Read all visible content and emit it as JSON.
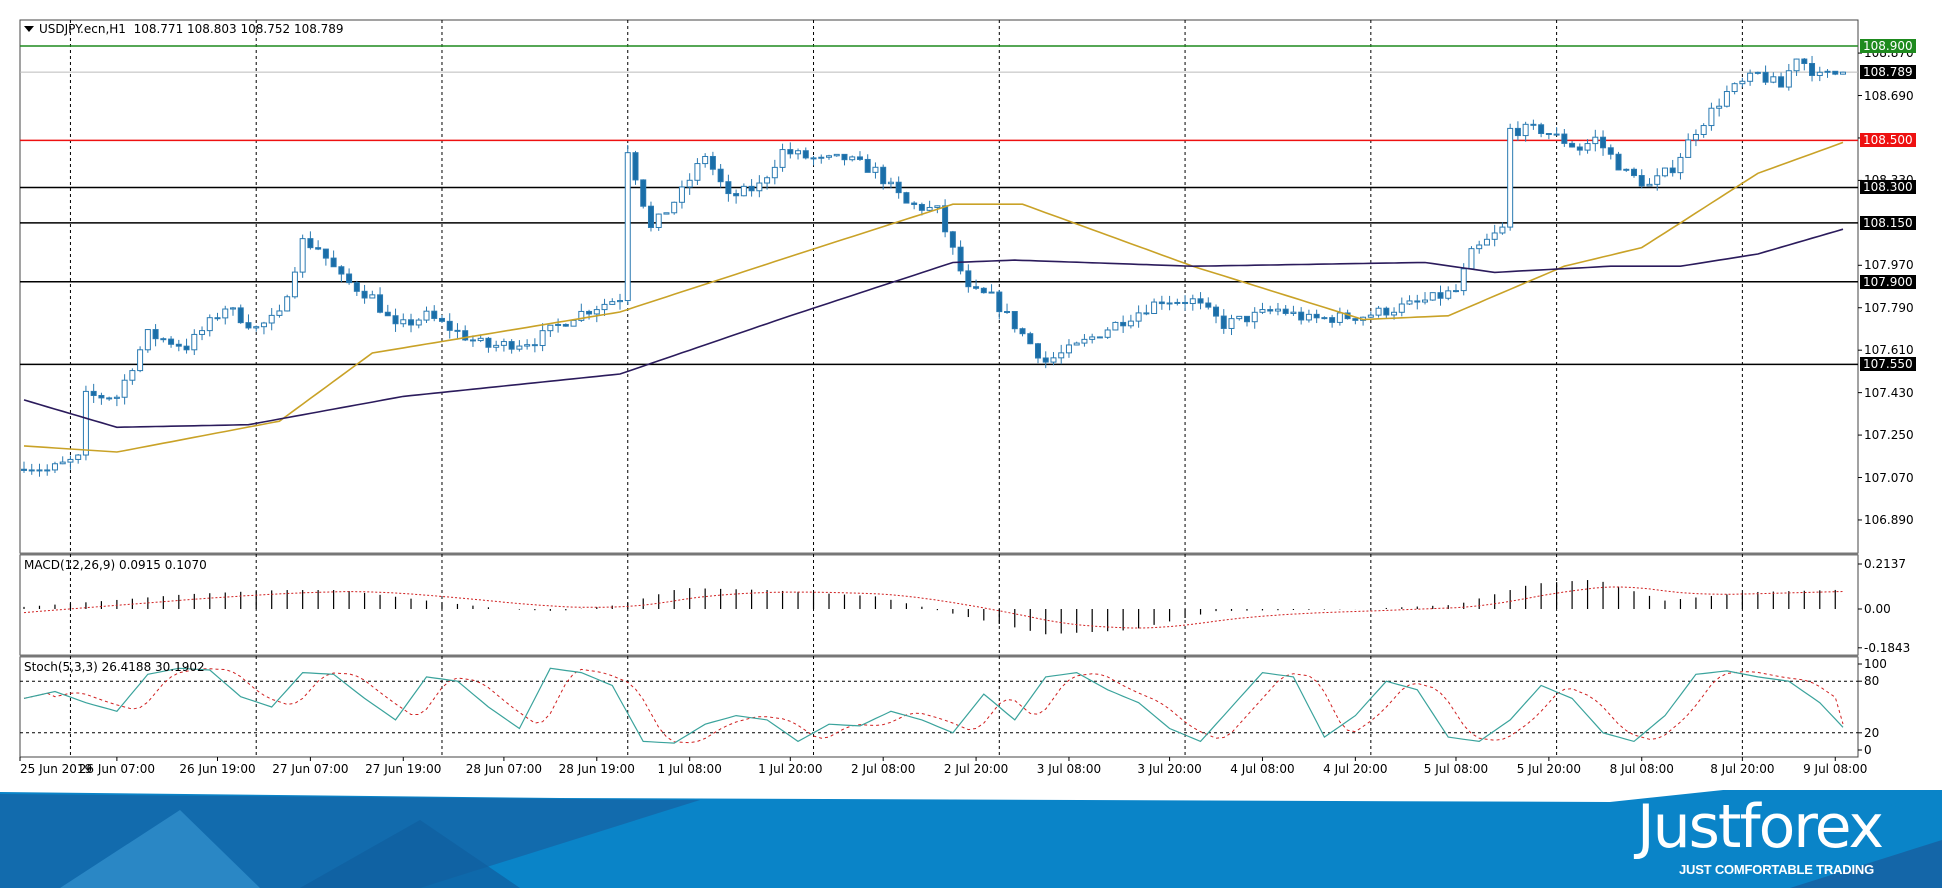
{
  "header": {
    "symbol": "USDJPY.ecn,H1",
    "open": "108.771",
    "high": "108.803",
    "low": "108.752",
    "close": "108.789"
  },
  "colors": {
    "bull_body": "#ffffff",
    "bear_body": "#1a6ea8",
    "candle_outline": "#2a7ab2",
    "ma_fast": "#c9a227",
    "ma_slow": "#2b1b5c",
    "level_green": "#1e8a1e",
    "level_red": "#ee1111",
    "level_black": "#000000",
    "stoch_main": "#3aa39c",
    "stoch_signal": "#d02020",
    "brand_blue": "#0a84c8"
  },
  "chart_data": {
    "type": "candlestick",
    "bars": 236,
    "price_range": [
      106.8,
      109.0
    ],
    "price_ticks": [
      "108.870",
      "108.690",
      "108.510",
      "108.330",
      "107.970",
      "107.790",
      "107.610",
      "107.430",
      "107.250",
      "107.070",
      "106.890"
    ],
    "levels": [
      {
        "price": 108.9,
        "label": "108.900",
        "color": "green"
      },
      {
        "price": 108.789,
        "label": "108.789",
        "color": "bid"
      },
      {
        "price": 108.5,
        "label": "108.500",
        "color": "red"
      },
      {
        "price": 108.3,
        "label": "108.300",
        "color": "black"
      },
      {
        "price": 108.15,
        "label": "108.150",
        "color": "black"
      },
      {
        "price": 107.9,
        "label": "107.900",
        "color": "black"
      },
      {
        "price": 107.55,
        "label": "107.550",
        "color": "black"
      }
    ],
    "close_keypoints": [
      [
        0,
        107.125
      ],
      [
        3,
        107.1
      ],
      [
        7,
        107.15
      ],
      [
        8,
        107.414
      ],
      [
        12,
        107.414
      ],
      [
        16,
        107.677
      ],
      [
        21,
        107.625
      ],
      [
        26,
        107.793
      ],
      [
        30,
        107.703
      ],
      [
        33,
        107.756
      ],
      [
        36,
        108.071
      ],
      [
        38,
        108.045
      ],
      [
        41,
        107.913
      ],
      [
        45,
        107.834
      ],
      [
        48,
        107.703
      ],
      [
        52,
        107.756
      ],
      [
        58,
        107.651
      ],
      [
        60,
        107.625
      ],
      [
        66,
        107.651
      ],
      [
        71,
        107.756
      ],
      [
        77,
        107.834
      ],
      [
        78,
        108.465
      ],
      [
        81,
        108.123
      ],
      [
        85,
        108.281
      ],
      [
        88,
        108.439
      ],
      [
        91,
        108.255
      ],
      [
        95,
        108.307
      ],
      [
        98,
        108.454
      ],
      [
        103,
        108.412
      ],
      [
        106,
        108.423
      ],
      [
        110,
        108.37
      ],
      [
        114,
        108.229
      ],
      [
        118,
        108.202
      ],
      [
        122,
        107.861
      ],
      [
        125,
        107.834
      ],
      [
        129,
        107.677
      ],
      [
        132,
        107.561
      ],
      [
        136,
        107.625
      ],
      [
        140,
        107.703
      ],
      [
        143,
        107.756
      ],
      [
        147,
        107.824
      ],
      [
        151,
        107.819
      ],
      [
        155,
        107.719
      ],
      [
        162,
        107.782
      ],
      [
        166,
        107.74
      ],
      [
        173,
        107.756
      ],
      [
        180,
        107.808
      ],
      [
        185,
        107.861
      ],
      [
        187,
        108.018
      ],
      [
        191,
        108.123
      ],
      [
        192,
        108.544
      ],
      [
        196,
        108.544
      ],
      [
        201,
        108.465
      ],
      [
        203,
        108.507
      ],
      [
        207,
        108.36
      ],
      [
        210,
        108.307
      ],
      [
        213,
        108.386
      ],
      [
        216,
        108.544
      ],
      [
        220,
        108.701
      ],
      [
        224,
        108.78
      ],
      [
        227,
        108.727
      ],
      [
        229,
        108.859
      ],
      [
        232,
        108.769
      ],
      [
        235,
        108.789
      ]
    ],
    "ma_fast_keypoints": [
      [
        0,
        107.204
      ],
      [
        12,
        107.178
      ],
      [
        33,
        107.309
      ],
      [
        45,
        107.598
      ],
      [
        77,
        107.772
      ],
      [
        100,
        108.018
      ],
      [
        120,
        108.229
      ],
      [
        129,
        108.229
      ],
      [
        151,
        107.966
      ],
      [
        173,
        107.74
      ],
      [
        184,
        107.756
      ],
      [
        199,
        107.966
      ],
      [
        209,
        108.045
      ],
      [
        224,
        108.36
      ],
      [
        235,
        108.491
      ]
    ],
    "ma_slow_keypoints": [
      [
        0,
        107.399
      ],
      [
        12,
        107.283
      ],
      [
        29,
        107.294
      ],
      [
        49,
        107.414
      ],
      [
        77,
        107.509
      ],
      [
        99,
        107.756
      ],
      [
        120,
        107.982
      ],
      [
        128,
        107.992
      ],
      [
        151,
        107.966
      ],
      [
        181,
        107.982
      ],
      [
        190,
        107.94
      ],
      [
        205,
        107.966
      ],
      [
        214,
        107.966
      ],
      [
        224,
        108.018
      ],
      [
        235,
        108.123
      ]
    ],
    "macd": {
      "label": "MACD(12,26,9) 0.0915 0.1070",
      "ticks": [
        "0.2137",
        "0.00",
        "-0.1843"
      ],
      "range": [
        -0.1843,
        0.2137
      ],
      "keypoints": [
        [
          0,
          0.01
        ],
        [
          11,
          0.04
        ],
        [
          21,
          0.07
        ],
        [
          33,
          0.09
        ],
        [
          41,
          0.09
        ],
        [
          52,
          0.04
        ],
        [
          62,
          0.0
        ],
        [
          69,
          -0.01
        ],
        [
          77,
          0.02
        ],
        [
          85,
          0.1
        ],
        [
          96,
          0.09
        ],
        [
          110,
          0.06
        ],
        [
          121,
          -0.03
        ],
        [
          132,
          -0.12
        ],
        [
          143,
          -0.1
        ],
        [
          154,
          -0.01
        ],
        [
          173,
          0.0
        ],
        [
          185,
          0.02
        ],
        [
          195,
          0.12
        ],
        [
          203,
          0.14
        ],
        [
          212,
          0.04
        ],
        [
          223,
          0.08
        ],
        [
          235,
          0.0915
        ]
      ]
    },
    "stoch": {
      "label": "Stoch(5,3,3) 26.4188 30.1902",
      "ticks": [
        "100",
        "80",
        "20",
        "0"
      ],
      "levels": [
        80,
        20
      ],
      "k_every_4_bars": [
        60,
        68,
        55,
        45,
        88,
        95,
        93,
        62,
        50,
        90,
        88,
        60,
        35,
        85,
        80,
        50,
        25,
        95,
        90,
        75,
        10,
        8,
        30,
        40,
        35,
        10,
        30,
        28,
        45,
        35,
        20,
        65,
        35,
        85,
        90,
        70,
        55,
        25,
        10,
        50,
        90,
        85,
        15,
        40,
        80,
        70,
        15,
        10,
        35,
        75,
        60,
        20,
        10,
        40,
        88,
        92,
        85,
        80,
        55,
        26.4
      ]
    },
    "time_labels": [
      "25 Jun 2019",
      "26 Jun 07:00",
      "26 Jun 19:00",
      "27 Jun 07:00",
      "27 Jun 19:00",
      "28 Jun 07:00",
      "28 Jun 19:00",
      "1 Jul 08:00",
      "1 Jul 20:00",
      "2 Jul 08:00",
      "2 Jul 20:00",
      "3 Jul 08:00",
      "3 Jul 20:00",
      "4 Jul 08:00",
      "4 Jul 20:00",
      "5 Jul 08:00",
      "5 Jul 20:00",
      "8 Jul 08:00",
      "8 Jul 20:00",
      "9 Jul 08:00"
    ]
  },
  "brand": {
    "logo": "Justforex",
    "tagline": "JUST COMFORTABLE TRADING"
  }
}
